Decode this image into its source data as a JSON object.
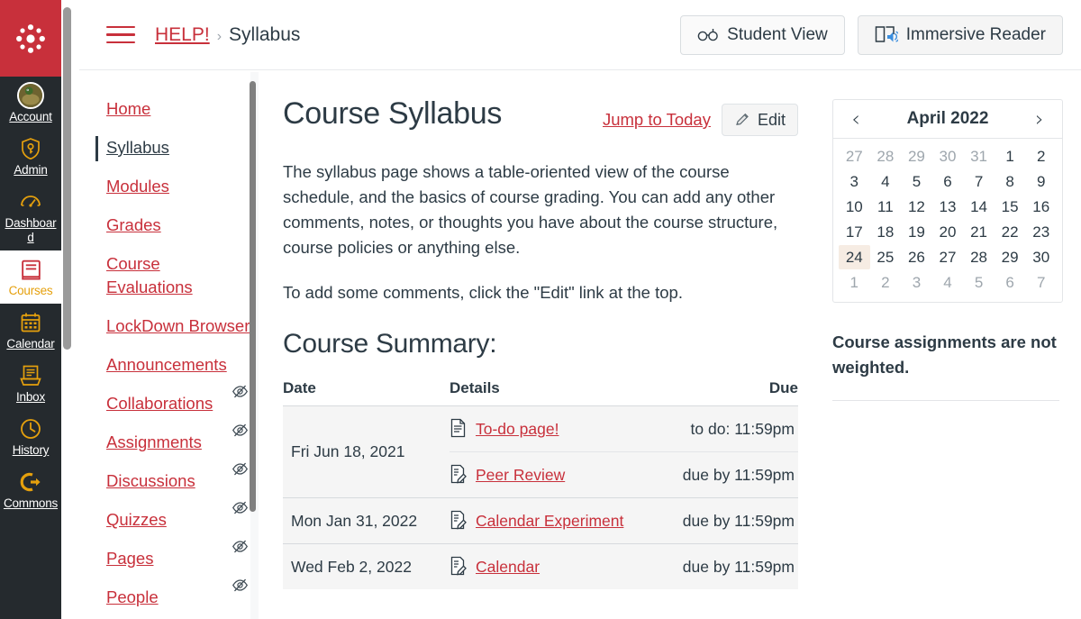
{
  "global_nav": {
    "logo": "canvas-logo",
    "items": [
      {
        "label": "Account",
        "icon": "avatar-icon",
        "active": false
      },
      {
        "label": "Admin",
        "icon": "shield-key-icon",
        "active": false
      },
      {
        "label": "Dashboard",
        "icon": "gauge-icon",
        "active": false
      },
      {
        "label": "Courses",
        "icon": "book-icon",
        "active": true
      },
      {
        "label": "Calendar",
        "icon": "calendar-icon",
        "active": false
      },
      {
        "label": "Inbox",
        "icon": "inbox-icon",
        "active": false
      },
      {
        "label": "History",
        "icon": "clock-icon",
        "active": false
      },
      {
        "label": "Commons",
        "icon": "arrow-exit-icon",
        "active": false
      }
    ]
  },
  "header": {
    "menu_icon": "hamburger-icon",
    "breadcrumb": {
      "course": "HELP!",
      "separator": "›",
      "current": "Syllabus"
    },
    "student_view_label": "Student View",
    "student_view_icon": "eyeglasses-icon",
    "immersive_reader_label": "Immersive Reader",
    "immersive_reader_icon": "book-speaker-icon"
  },
  "course_nav": {
    "items": [
      {
        "label": "Home",
        "active": false,
        "hidden_icon": false
      },
      {
        "label": "Syllabus",
        "active": true,
        "hidden_icon": false
      },
      {
        "label": "Modules",
        "active": false,
        "hidden_icon": false
      },
      {
        "label": "Grades",
        "active": false,
        "hidden_icon": false
      },
      {
        "label": "Course Evaluations",
        "active": false,
        "hidden_icon": false
      },
      {
        "label": "LockDown Browser",
        "active": false,
        "hidden_icon": false
      },
      {
        "label": "Announcements",
        "active": false,
        "hidden_icon": false
      },
      {
        "label": "Collaborations",
        "active": false,
        "hidden_icon": true
      },
      {
        "label": "Assignments",
        "active": false,
        "hidden_icon": true
      },
      {
        "label": "Discussions",
        "active": false,
        "hidden_icon": true
      },
      {
        "label": "Quizzes",
        "active": false,
        "hidden_icon": true
      },
      {
        "label": "Pages",
        "active": false,
        "hidden_icon": true
      },
      {
        "label": "People",
        "active": false,
        "hidden_icon": true
      }
    ]
  },
  "main": {
    "title": "Course Syllabus",
    "jump_to_today": "Jump to Today",
    "edit_label": "Edit",
    "edit_icon": "pencil-icon",
    "paragraph_1": "The syllabus page shows a table-oriented view of the course schedule, and the basics of course grading. You can add any other comments, notes, or thoughts you have about the course structure, course policies or anything else.",
    "paragraph_2": "To add some comments, click the \"Edit\" link at the top.",
    "summary_title": "Course Summary:",
    "table": {
      "headers": {
        "date": "Date",
        "details": "Details",
        "due": "Due"
      },
      "groups": [
        {
          "date": "Fri Jun 18, 2021",
          "rows": [
            {
              "icon": "document-icon",
              "title": "To-do page!",
              "due": "to do: 11:59pm"
            },
            {
              "icon": "assignment-icon",
              "title": "Peer Review",
              "due": "due by 11:59pm"
            }
          ]
        },
        {
          "date": "Mon Jan 31, 2022",
          "rows": [
            {
              "icon": "assignment-icon",
              "title": "Calendar Experiment",
              "due": "due by 11:59pm"
            }
          ]
        },
        {
          "date": "Wed Feb 2, 2022",
          "rows": [
            {
              "icon": "assignment-icon",
              "title": "Calendar",
              "due": "due by 11:59pm"
            }
          ]
        }
      ]
    }
  },
  "sidebar": {
    "calendar": {
      "title": "April 2022",
      "prev_icon": "chevron-left-icon",
      "next_icon": "chevron-right-icon",
      "today": 24,
      "weeks": [
        [
          {
            "d": 27,
            "o": true
          },
          {
            "d": 28,
            "o": true
          },
          {
            "d": 29,
            "o": true
          },
          {
            "d": 30,
            "o": true
          },
          {
            "d": 31,
            "o": true
          },
          {
            "d": 1,
            "o": false
          },
          {
            "d": 2,
            "o": false
          }
        ],
        [
          {
            "d": 3,
            "o": false
          },
          {
            "d": 4,
            "o": false
          },
          {
            "d": 5,
            "o": false
          },
          {
            "d": 6,
            "o": false
          },
          {
            "d": 7,
            "o": false
          },
          {
            "d": 8,
            "o": false
          },
          {
            "d": 9,
            "o": false
          }
        ],
        [
          {
            "d": 10,
            "o": false
          },
          {
            "d": 11,
            "o": false
          },
          {
            "d": 12,
            "o": false
          },
          {
            "d": 13,
            "o": false
          },
          {
            "d": 14,
            "o": false
          },
          {
            "d": 15,
            "o": false
          },
          {
            "d": 16,
            "o": false
          }
        ],
        [
          {
            "d": 17,
            "o": false
          },
          {
            "d": 18,
            "o": false
          },
          {
            "d": 19,
            "o": false
          },
          {
            "d": 20,
            "o": false
          },
          {
            "d": 21,
            "o": false
          },
          {
            "d": 22,
            "o": false
          },
          {
            "d": 23,
            "o": false
          }
        ],
        [
          {
            "d": 24,
            "o": false,
            "today": true
          },
          {
            "d": 25,
            "o": false
          },
          {
            "d": 26,
            "o": false
          },
          {
            "d": 27,
            "o": false
          },
          {
            "d": 28,
            "o": false
          },
          {
            "d": 29,
            "o": false
          },
          {
            "d": 30,
            "o": false
          }
        ],
        [
          {
            "d": 1,
            "o": true
          },
          {
            "d": 2,
            "o": true
          },
          {
            "d": 3,
            "o": true
          },
          {
            "d": 4,
            "o": true
          },
          {
            "d": 5,
            "o": true
          },
          {
            "d": 6,
            "o": true
          },
          {
            "d": 7,
            "o": true
          }
        ]
      ]
    },
    "weight_note": "Course assignments are not weighted."
  },
  "colors": {
    "brand_crimson": "#C8303B",
    "nav_dark": "#252a2e",
    "text_dark": "#2D3B45",
    "accent_gold": "#E5A00D",
    "today_highlight": "#f6ece3"
  }
}
